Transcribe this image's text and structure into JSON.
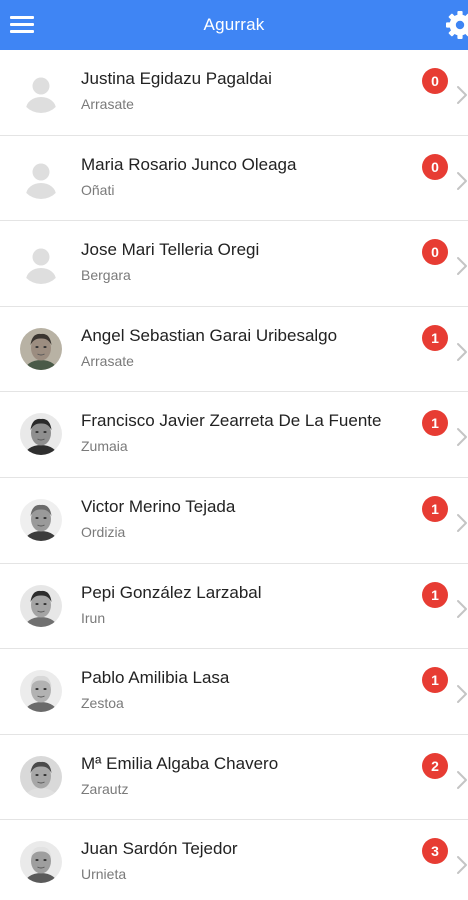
{
  "header": {
    "title": "Agurrak",
    "menu_icon": "hamburger-menu-icon",
    "settings_icon": "gear-icon",
    "background_color": "#3f85f4"
  },
  "contacts": [
    {
      "name": "Justina Egidazu Pagaldai",
      "town": "Arrasate",
      "count": "0",
      "avatar": "placeholder"
    },
    {
      "name": "Maria Rosario Junco Oleaga",
      "town": "Oñati",
      "count": "0",
      "avatar": "placeholder"
    },
    {
      "name": "Jose Mari Telleria Oregi",
      "town": "Bergara",
      "count": "0",
      "avatar": "placeholder"
    },
    {
      "name": "Angel Sebastian Garai Uribesalgo",
      "town": "Arrasate",
      "count": "1",
      "avatar": "photo"
    },
    {
      "name": "Francisco Javier Zearreta De La Fuente",
      "town": "Zumaia",
      "count": "1",
      "avatar": "photo"
    },
    {
      "name": "Victor Merino Tejada",
      "town": "Ordizia",
      "count": "1",
      "avatar": "photo"
    },
    {
      "name": "Pepi González Larzabal",
      "town": "Irun",
      "count": "1",
      "avatar": "photo"
    },
    {
      "name": "Pablo Amilibia Lasa",
      "town": "Zestoa",
      "count": "1",
      "avatar": "photo"
    },
    {
      "name": "Mª Emilia Algaba Chavero",
      "town": "Zarautz",
      "count": "2",
      "avatar": "photo"
    },
    {
      "name": "Juan Sardón Tejedor",
      "town": "Urnieta",
      "count": "3",
      "avatar": "photo"
    }
  ],
  "badge_color": "#e73c33"
}
